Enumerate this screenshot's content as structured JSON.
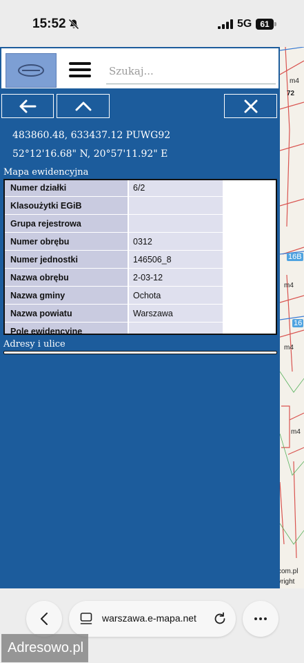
{
  "status_bar": {
    "time": "15:52",
    "network": "5G",
    "battery": "61"
  },
  "toolbar": {
    "search_placeholder": "Szukaj..."
  },
  "coordinates": {
    "puwg": "483860.48, 633437.12 PUWG92",
    "wgs": "52°12'16.68\" N, 20°57'11.92\" E"
  },
  "map_panel": {
    "title": "Mapa ewidencyjna",
    "rows": [
      {
        "label": "Numer działki",
        "value": "6/2"
      },
      {
        "label": "Klasoużytki EGiB",
        "value": ""
      },
      {
        "label": "Grupa rejestrowa",
        "value": ""
      },
      {
        "label": "Numer obrębu",
        "value": "0312"
      },
      {
        "label": "Numer jednostki",
        "value": "146506_8"
      },
      {
        "label": "Nazwa obrębu",
        "value": "2-03-12"
      },
      {
        "label": "Nazwa gminy",
        "value": "Ochota"
      },
      {
        "label": "Nazwa powiatu",
        "value": "Warszawa"
      },
      {
        "label": "Pole ewidencyjne",
        "value": ""
      }
    ]
  },
  "addresses_panel": {
    "title": "Adresy i ulice"
  },
  "map": {
    "labels": [
      "m4",
      "72",
      "16B",
      "m4",
      "16",
      "m4",
      "m4",
      "com.pl",
      "yright"
    ]
  },
  "browser": {
    "url": "warszawa.e-mapa.net"
  },
  "watermark": "Adresowo.pl",
  "colors": {
    "panel_blue": "#1c5c9c",
    "row_label_bg": "#c9cbe0",
    "row_value_bg": "#dfe0ee"
  }
}
